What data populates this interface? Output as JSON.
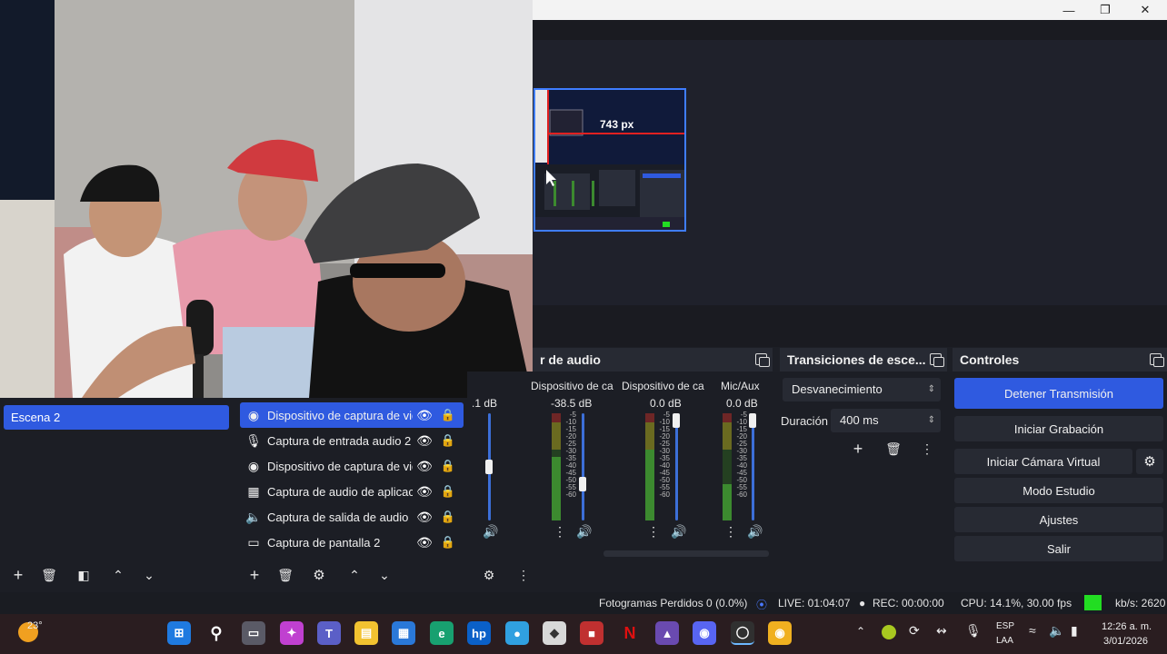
{
  "window": {
    "minimize_icon": "minimize-icon",
    "maximize_icon": "restore-icon",
    "close_icon": "close-icon"
  },
  "preview": {
    "measure_label": "743 px"
  },
  "scenes": {
    "items": [
      "Escena 2"
    ]
  },
  "sources": {
    "items": [
      {
        "label": "Dispositivo de captura de video",
        "icon": "camera-icon",
        "visible": true,
        "locked": false,
        "selected": true
      },
      {
        "label": "Captura de entrada audio 2",
        "icon": "microphone-icon",
        "visible": true,
        "locked": true,
        "selected": false
      },
      {
        "label": "Dispositivo de captura de video",
        "icon": "camera-icon",
        "visible": true,
        "locked": true,
        "selected": false
      },
      {
        "label": "Captura de audio de aplicación",
        "icon": "app-audio-icon",
        "visible": true,
        "locked": false,
        "selected": false
      },
      {
        "label": "Captura de salida de audio",
        "icon": "speaker-icon",
        "visible": true,
        "locked": false,
        "selected": false
      },
      {
        "label": "Captura de pantalla 2",
        "icon": "monitor-icon",
        "visible": true,
        "locked": false,
        "selected": false
      }
    ]
  },
  "mixer": {
    "title": "r de audio",
    "channels": [
      {
        "name": "",
        "db": ".1 dB",
        "level": 0.55
      },
      {
        "name": "Dispositivo de ca",
        "db": "-38.5 dB",
        "level": 0.35
      },
      {
        "name": "Dispositivo de ca",
        "db": "0.0 dB",
        "level": 0.95
      },
      {
        "name": "Mic/Aux",
        "db": "0.0 dB",
        "level": 0.95
      }
    ]
  },
  "transitions": {
    "title": "Transiciones de esce...",
    "selected": "Desvanecimiento",
    "duration_label": "Duración",
    "duration_value": "400 ms"
  },
  "controls": {
    "title": "Controles",
    "stop_stream": "Detener Transmisión",
    "start_recording": "Iniciar Grabación",
    "start_virtual_cam": "Iniciar Cámara Virtual",
    "studio_mode": "Modo Estudio",
    "settings": "Ajustes",
    "exit": "Salir"
  },
  "status": {
    "dropped_frames": "Fotogramas Perdidos 0 (0.0%)",
    "live": "LIVE: 01:04:07",
    "rec": "REC: 00:00:00",
    "cpu": "CPU: 14.1%, 30.00 fps",
    "kbs": "kb/s: 2620",
    "health_color": "#22dd22"
  },
  "taskbar": {
    "weather_temp": "23°",
    "language": "ESP",
    "layout": "LAA",
    "time": "12:26 a. m.",
    "date": "3/01/2026"
  }
}
